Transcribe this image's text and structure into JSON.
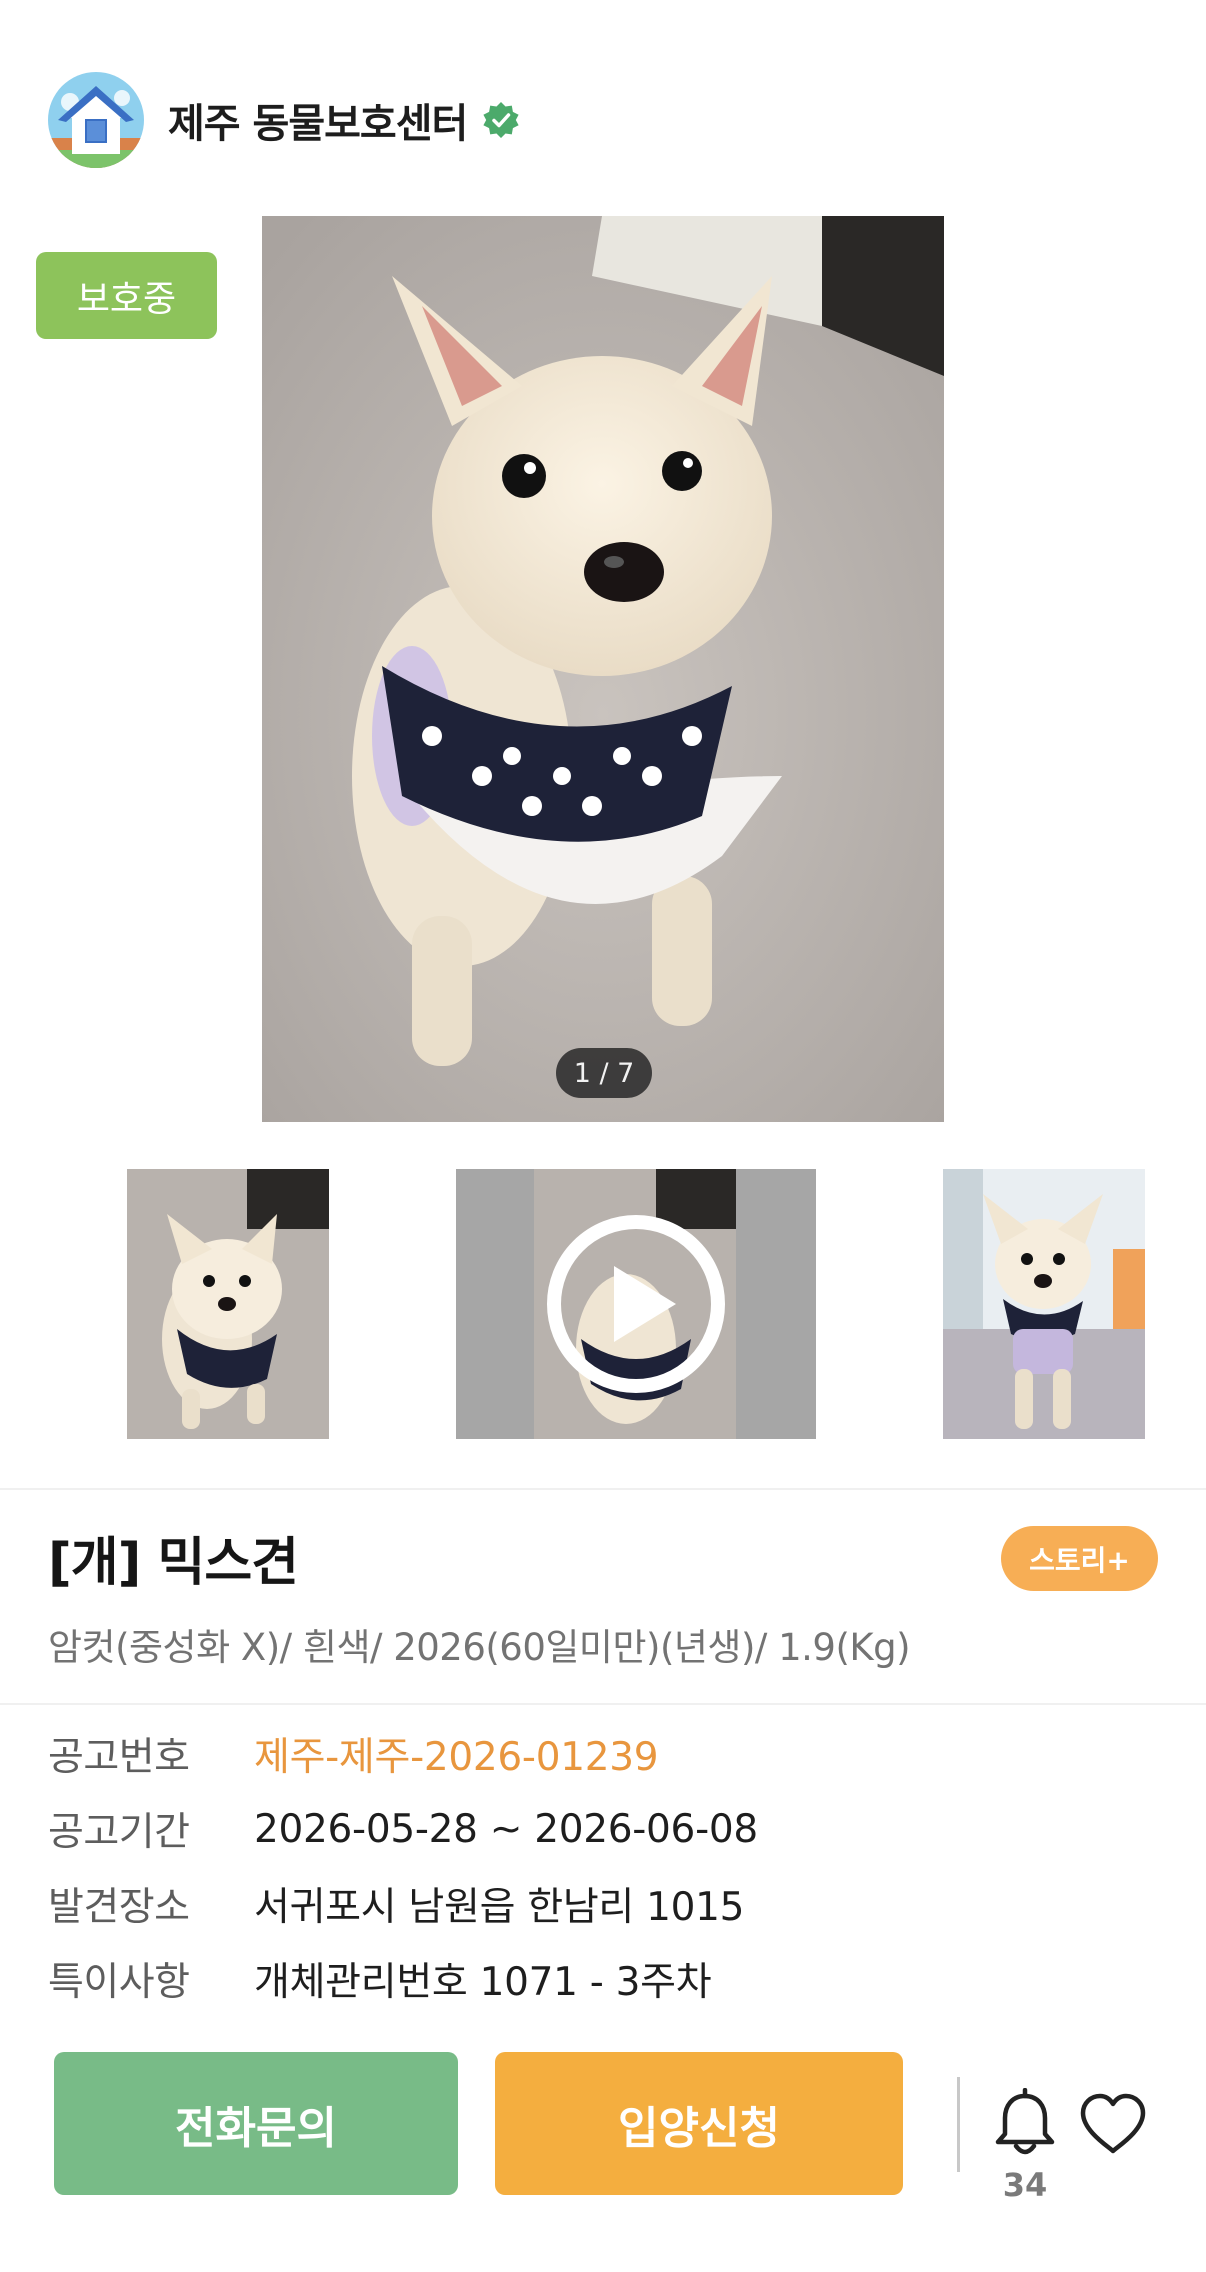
{
  "header": {
    "shelter_name": "제주 동물보호센터",
    "avatar_icon": "house-logo-icon",
    "verified_icon": "verified-badge-icon",
    "verified_color": "#4caa6b"
  },
  "gallery": {
    "status_badge": "보호중",
    "page_indicator": "1 / 7",
    "current_page": 1,
    "total_pages": 7,
    "thumbnails": [
      {
        "type": "photo"
      },
      {
        "type": "video",
        "icon": "play-icon"
      },
      {
        "type": "photo"
      }
    ]
  },
  "animal": {
    "title": "[개] 믹스견",
    "story_button": "스토리+",
    "description": "암컷(중성화 X)/ 흰색/ 2026(60일미만)(년생)/ 1.9(Kg)"
  },
  "info": [
    {
      "label": "공고번호",
      "value": "제주-제주-2026-01239",
      "accent": true
    },
    {
      "label": "공고기간",
      "value": "2026-05-28 ~ 2026-06-08",
      "accent": false
    },
    {
      "label": "발견장소",
      "value": "서귀포시 남원읍 한남리 1015",
      "accent": false
    },
    {
      "label": "특이사항",
      "value": "개체관리번호 1071 - 3주차",
      "accent": false
    }
  ],
  "actions": {
    "call_button": "전화문의",
    "adopt_button": "입양신청",
    "bell_icon": "bell-icon",
    "bell_count": "34",
    "heart_icon": "heart-icon"
  },
  "colors": {
    "status_green": "#8dc35b",
    "story_orange": "#f7ae55",
    "accent_orange": "#e8963e",
    "call_green": "#78bb87",
    "adopt_orange": "#f4ae3f"
  }
}
